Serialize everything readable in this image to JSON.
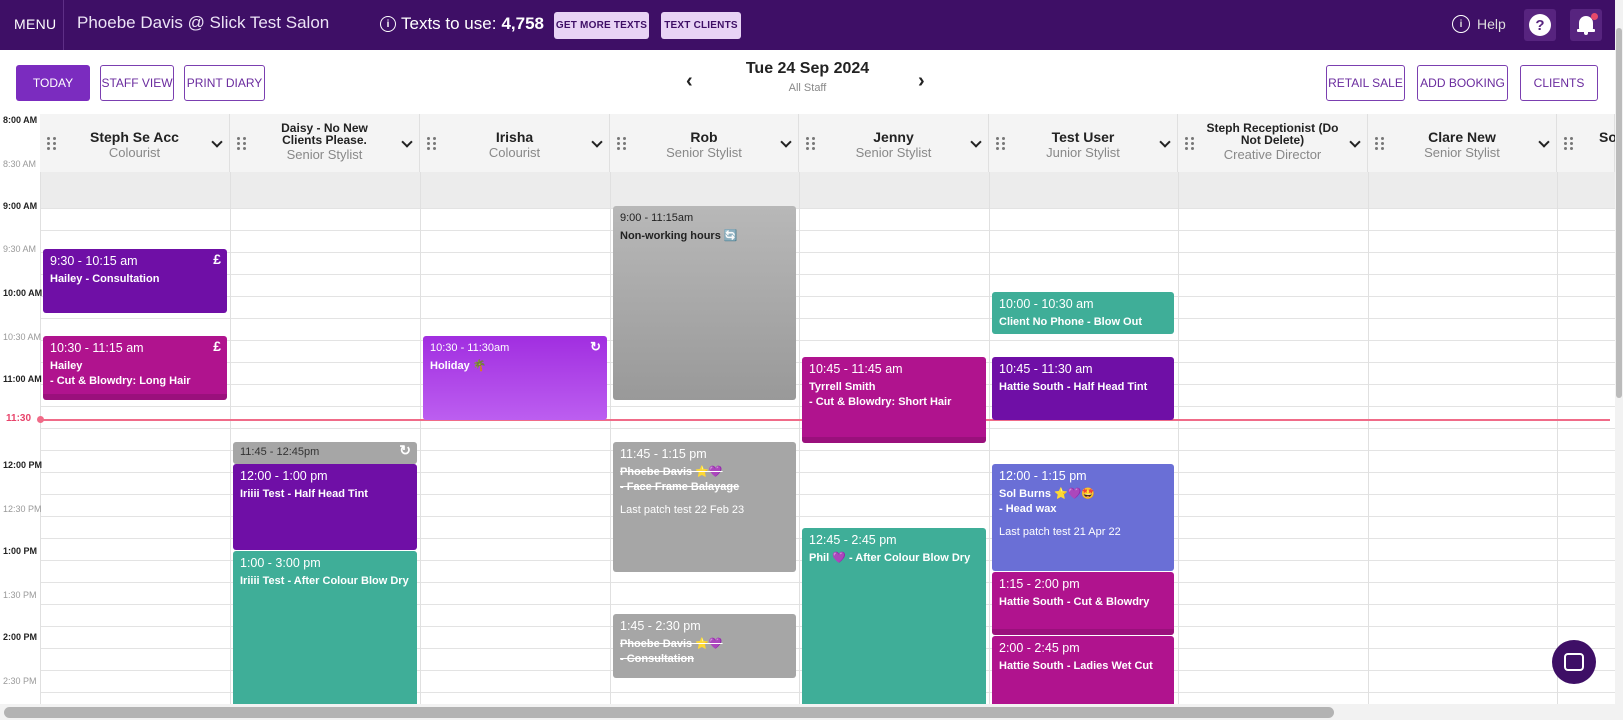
{
  "topbar": {
    "menu": "MENU",
    "account": "Phoebe Davis @ Slick Test Salon",
    "texts_label": "Texts to use:",
    "texts_count": "4,758",
    "get_more": "GET MORE TEXTS",
    "text_clients": "TEXT CLIENTS",
    "help": "Help"
  },
  "toolbar": {
    "today": "TODAY",
    "staff_view": "STAFF VIEW",
    "print_diary": "PRINT DIARY",
    "date": "Tue 24 Sep 2024",
    "scope": "All Staff",
    "retail_sale": "RETAIL SALE",
    "add_booking": "ADD BOOKING",
    "clients": "CLIENTS"
  },
  "times": [
    {
      "label": "8:00 AM",
      "major": true
    },
    {
      "label": "8:30 AM",
      "major": false
    },
    {
      "label": "9:00 AM",
      "major": true
    },
    {
      "label": "9:30 AM",
      "major": false
    },
    {
      "label": "10:00 AM",
      "major": true
    },
    {
      "label": "10:30 AM",
      "major": false
    },
    {
      "label": "11:00 AM",
      "major": true
    },
    {
      "label": "11:30 AM",
      "major": false
    },
    {
      "label": "12:00 PM",
      "major": true
    },
    {
      "label": "12:30 PM",
      "major": false
    },
    {
      "label": "1:00 PM",
      "major": true
    },
    {
      "label": "1:30 PM",
      "major": false
    },
    {
      "label": "2:00 PM",
      "major": true
    },
    {
      "label": "2:30 PM",
      "major": false
    }
  ],
  "now_label": "11:30",
  "staff": [
    {
      "name": "Steph Se Acc",
      "role": "Colourist"
    },
    {
      "name": "Daisy - No New Clients Please.",
      "role": "Senior Stylist"
    },
    {
      "name": "Irisha",
      "role": "Colourist"
    },
    {
      "name": "Rob",
      "role": "Senior Stylist"
    },
    {
      "name": "Jenny",
      "role": "Senior Stylist"
    },
    {
      "name": "Test User",
      "role": "Junior Stylist"
    },
    {
      "name": "Steph Receptionist (Do Not Delete)",
      "role": "Creative Director"
    },
    {
      "name": "Clare New",
      "role": "Senior Stylist"
    },
    {
      "name": "So",
      "role": ""
    }
  ],
  "colors": {
    "purple": "#6f0fa6",
    "magenta": "#b0138e",
    "violet": "#a12ee0",
    "grey": "#a6a6a6",
    "teal": "#3fae98",
    "blue": "#6a6fd6",
    "header": "#3e0f66"
  },
  "appointments": [
    {
      "time": "9:30 - 10:15 am",
      "client": "Hailey",
      "service": " - Consultation",
      "badge": "£"
    },
    {
      "time": "10:30 - 11:15 am",
      "client": "Hailey",
      "service": "- Cut & Blowdry: Long Hair",
      "badge": "£"
    },
    {
      "time": "11:45 - 12:45pm",
      "icon": "↻"
    },
    {
      "time": "12:00 - 1:00 pm",
      "client": "Iriiii Test",
      "service": " - Half Head Tint"
    },
    {
      "time": "1:00 - 3:00 pm",
      "client": "Iriiii Test",
      "service": " - After Colour Blow Dry"
    },
    {
      "time": "10:30 - 11:30am",
      "client": "Holiday 🌴",
      "icon": "↻"
    },
    {
      "time": "9:00 - 11:15am",
      "client": "Non-working hours 🔄"
    },
    {
      "time": "11:45 - 1:15 pm",
      "client": "Phoebe Davis ⭐💜",
      "service": "- Face Frame Balayage",
      "note": "Last patch test 22 Feb 23"
    },
    {
      "time": "1:45 - 2:30 pm",
      "client": "Phoebe Davis ⭐💜",
      "service": "- Consultation"
    },
    {
      "time": "10:45 - 11:45 am",
      "client": "Tyrrell Smith",
      "service": "- Cut & Blowdry: Short Hair"
    },
    {
      "time": "12:45 - 2:45 pm",
      "client": "Phil 💜",
      "service": " - After Colour Blow Dry"
    },
    {
      "time": "10:00 - 10:30 am",
      "client": "Client No Phone",
      "service": " - Blow Out"
    },
    {
      "time": "10:45 - 11:30 am",
      "client": "Hattie South",
      "service": " - Half Head Tint"
    },
    {
      "time": "12:00 - 1:15 pm",
      "client": "Sol Burns ⭐💜🤩",
      "service": "- Head wax",
      "note": "Last patch test 21 Apr 22"
    },
    {
      "time": "1:15 - 2:00 pm",
      "client": "Hattie South",
      "service": " - Cut & Blowdry"
    },
    {
      "time": "2:00 - 2:45 pm",
      "client": "Hattie South",
      "service": " - Ladies Wet Cut"
    }
  ]
}
